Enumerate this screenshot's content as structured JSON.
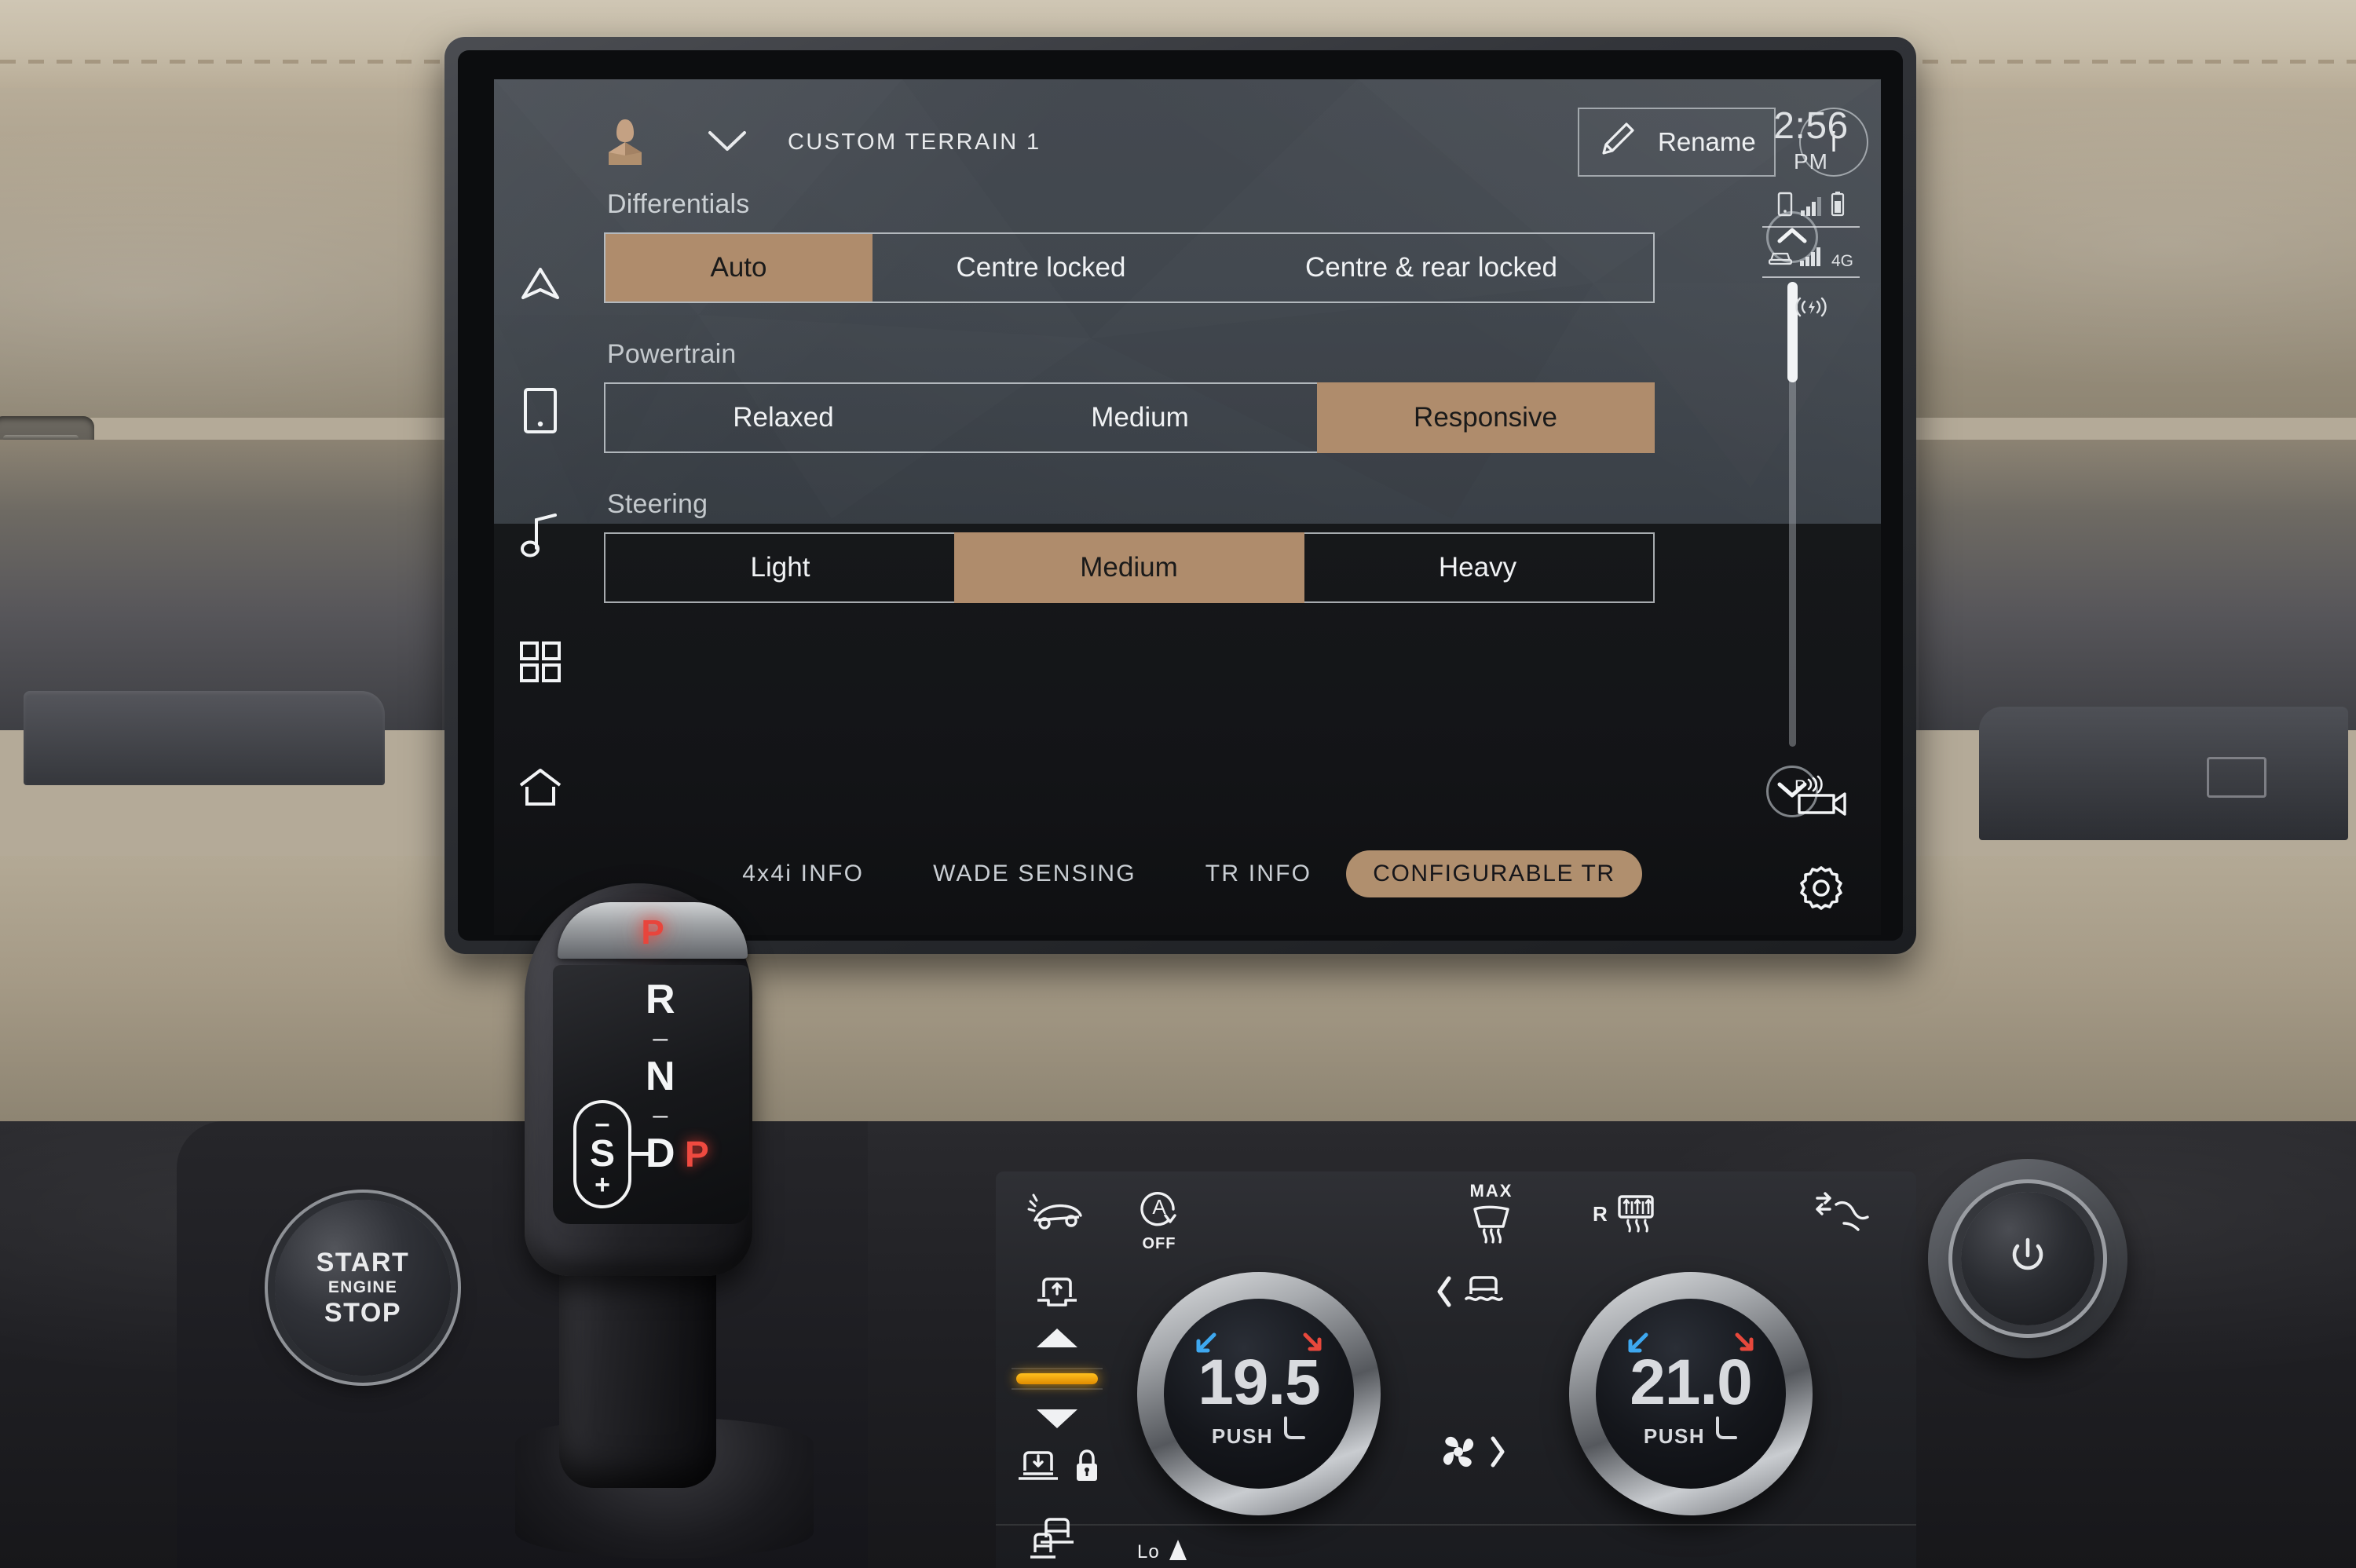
{
  "infotainment": {
    "header": {
      "profile_icon": "user-avatar-icon",
      "dropdown_icon": "chevron-down-icon",
      "profile_name": "CUSTOM TERRAIN 1",
      "rename_button": {
        "label": "Rename",
        "icon": "pencil-icon"
      },
      "info_button": {
        "label": "i",
        "icon": "info-icon"
      }
    },
    "status_bar": {
      "time": "2:56",
      "period": "PM",
      "phone_icon": "phone-icon",
      "phone_signal_icon": "signal-bars-icon",
      "battery_icon": "battery-icon",
      "vehicle_icon": "vehicle-icon",
      "vehicle_signal_icon": "signal-bars-icon",
      "network": "4G",
      "wireless_icon": "wireless-charging-icon"
    },
    "sidebar": {
      "items": [
        {
          "name": "navigation",
          "icon": "navigation-arrow-icon"
        },
        {
          "name": "phone",
          "icon": "phone-device-icon"
        },
        {
          "name": "media",
          "icon": "music-note-icon"
        },
        {
          "name": "apps",
          "icon": "apps-grid-icon"
        },
        {
          "name": "home",
          "icon": "home-icon"
        }
      ]
    },
    "settings_groups": [
      {
        "label": "Differentials",
        "options": [
          "Auto",
          "Centre locked",
          "Centre & rear locked"
        ],
        "selected": "Auto",
        "selected_index": 0
      },
      {
        "label": "Powertrain",
        "options": [
          "Relaxed",
          "Medium",
          "Responsive"
        ],
        "selected": "Responsive",
        "selected_index": 2
      },
      {
        "label": "Steering",
        "options": [
          "Light",
          "Medium",
          "Heavy"
        ],
        "selected": "Medium",
        "selected_index": 1
      }
    ],
    "scrollbar": {
      "up_icon": "chevron-up-icon",
      "down_icon": "chevron-down-icon",
      "thumb_position_percent": 4
    },
    "right_icons": [
      {
        "name": "park-camera",
        "icon": "park-assist-camera-icon"
      },
      {
        "name": "settings",
        "icon": "gear-icon"
      }
    ],
    "tabs": [
      {
        "label": "4x4i INFO",
        "active": false
      },
      {
        "label": "WADE SENSING",
        "active": false
      },
      {
        "label": "TR INFO",
        "active": false
      },
      {
        "label": "CONFIGURABLE TR",
        "active": true
      }
    ],
    "colors": {
      "accent": "#af8c6c",
      "accent_tab": "#b08f6e",
      "screen_lit": "#434950",
      "screen_dark": "#16181a",
      "text_primary": "#f0f2f4",
      "text_secondary": "#c9ced3"
    }
  },
  "gear_selector": {
    "top_indicator": "P",
    "positions": [
      "R",
      "N",
      "D"
    ],
    "sport_label": "S",
    "sport_minus": "–",
    "sport_plus": "+",
    "active_gear": "P",
    "active_color": "#ef4a40"
  },
  "start_button": {
    "line1": "START",
    "line2": "ENGINE",
    "line3": "STOP"
  },
  "power_knob": {
    "icon": "power-icon"
  },
  "climate": {
    "top_buttons": [
      {
        "name": "traction-control-off",
        "icon": "traction-control-icon",
        "label": ""
      },
      {
        "name": "auto-start-stop-off",
        "icon": "auto-start-stop-icon",
        "label": "OFF"
      },
      {
        "name": "max-defrost",
        "icon": "front-defrost-icon",
        "label": "MAX"
      },
      {
        "name": "rear-defrost",
        "icon": "rear-defrost-icon",
        "label": "R"
      },
      {
        "name": "air-recirculation",
        "icon": "recirculation-icon",
        "label": ""
      }
    ],
    "left_knob": {
      "temperature": "19.5",
      "push_label": "PUSH",
      "seat_icon": "seat-icon",
      "cool_arrow_icon": "cool-arrow-icon",
      "heat_arrow_icon": "heat-arrow-icon"
    },
    "right_knob": {
      "temperature": "21.0",
      "push_label": "PUSH",
      "seat_icon": "seat-icon",
      "cool_arrow_icon": "cool-arrow-icon",
      "heat_arrow_icon": "heat-arrow-icon"
    },
    "suspension": {
      "raise_icon": "suspension-raise-icon",
      "up_icon": "triangle-up-icon",
      "indicator_lit": true,
      "down_icon": "triangle-down-icon",
      "lower_icon": "suspension-lower-icon",
      "lock_icon": "lock-icon",
      "access_icon": "vehicle-access-icon"
    },
    "centre": {
      "wade_icon": "wade-sensing-icon",
      "wade_chevron": "chevron-left-icon",
      "fan_icon": "fan-icon",
      "fan_chevron": "chevron-right-icon",
      "low_label": "Lo"
    }
  }
}
